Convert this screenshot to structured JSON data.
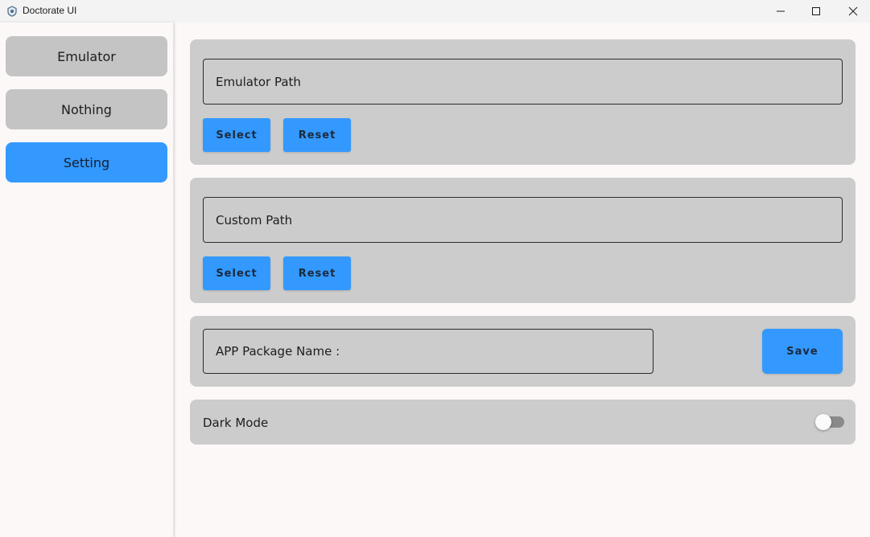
{
  "window": {
    "title": "Doctorate UI",
    "icon": "app-shield-icon",
    "controls": {
      "minimize": "minimize-icon",
      "maximize": "maximize-icon",
      "close": "close-icon"
    }
  },
  "sidebar": {
    "items": [
      {
        "label": "Emulator",
        "active": false
      },
      {
        "label": "Nothing",
        "active": false
      },
      {
        "label": "Setting",
        "active": true
      }
    ]
  },
  "emulator_path": {
    "field_text": "Emulator Path",
    "select_label": "Select",
    "reset_label": "Reset"
  },
  "custom_path": {
    "field_text": "Custom Path",
    "select_label": "Select",
    "reset_label": "Reset"
  },
  "package": {
    "field_text": "APP Package Name :",
    "save_label": "Save"
  },
  "dark_mode": {
    "label": "Dark Mode",
    "enabled": false
  },
  "colors": {
    "accent": "#3399ff",
    "card_bg": "#cccccc",
    "nav_inactive": "#c4c4c4",
    "page_bg": "#fcf8f8"
  }
}
